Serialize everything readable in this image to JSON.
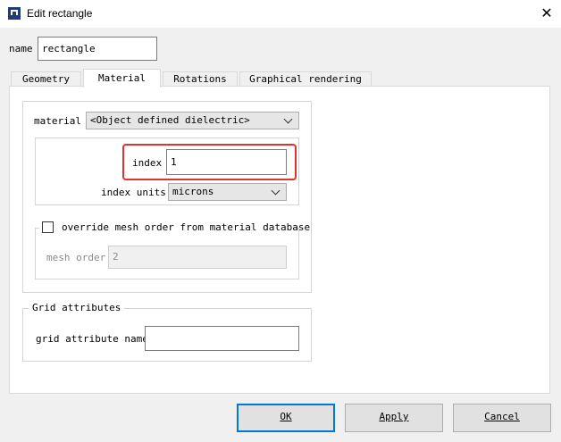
{
  "window": {
    "title": "Edit rectangle",
    "close_glyph": "✕"
  },
  "name_field": {
    "label": "name",
    "value": "rectangle"
  },
  "tabs": [
    {
      "label": "Geometry"
    },
    {
      "label": "Material"
    },
    {
      "label": "Rotations"
    },
    {
      "label": "Graphical rendering"
    }
  ],
  "material": {
    "label": "material",
    "value": "<Object defined dielectric>",
    "index_label": "index",
    "index_value": "1",
    "index_units_label": "index units",
    "index_units_value": "microns"
  },
  "mesh": {
    "override_label": "override mesh order from material database",
    "override_checked": false,
    "order_label": "mesh order",
    "order_value": "2"
  },
  "grid": {
    "group_title": "Grid attributes",
    "name_label": "grid attribute name",
    "name_value": ""
  },
  "buttons": {
    "ok": "OK",
    "apply": "Apply",
    "cancel": "Cancel"
  },
  "colors": {
    "highlight": "#e0332b",
    "default_button_border": "#0078d7",
    "app_icon": "#1f3d7a"
  }
}
